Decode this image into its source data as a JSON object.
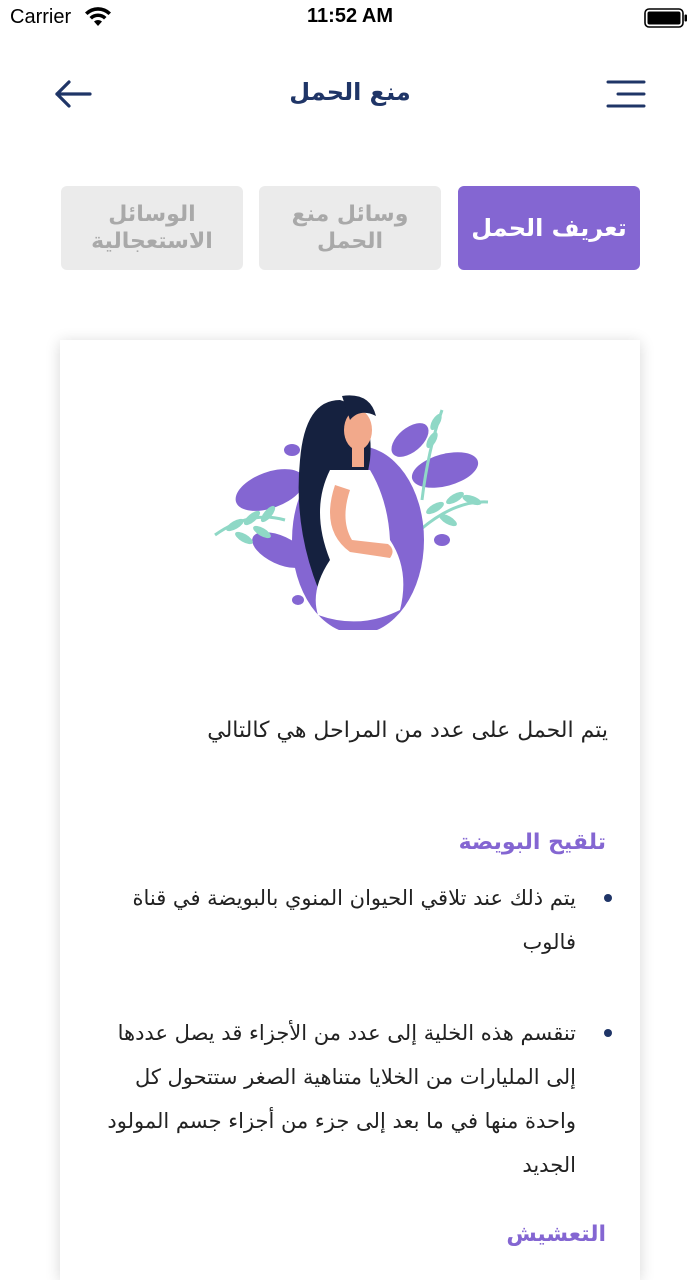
{
  "status_bar": {
    "carrier": "Carrier",
    "time": "11:52 AM"
  },
  "nav": {
    "title": "منع الحمل",
    "back_icon": "arrow-left-icon",
    "menu_icon": "hamburger-menu-icon"
  },
  "tabs": [
    {
      "label": "تعريف الحمل",
      "active": true
    },
    {
      "label": "وسائل منع الحمل",
      "active": false
    },
    {
      "label": "الوسائل الاستعجالية",
      "active": false
    }
  ],
  "content": {
    "illustration": "pregnant-woman-illustration",
    "intro": "يتم  الحمل على عدد من المراحل هي كالتالي",
    "section1_title": "تلقيح البويضة",
    "bullets": [
      "يتم ذلك عند تلاقي الحيوان المنوي بالبويضة في قناة فالوب",
      "تنقسم هذه الخلية إلى عدد من الأجزاء قد يصل عددها إلى المليارات من الخلايا متناهية الصغر ستتحول كل واحدة منها في ما بعد إلى جزء من أجزاء جسم المولود الجديد"
    ],
    "section2_title": "التعشيش"
  },
  "colors": {
    "accent": "#8466d2",
    "navy": "#1f3567",
    "inactive_tab": "#ebebeb",
    "inactive_text": "#a9a9a9"
  }
}
